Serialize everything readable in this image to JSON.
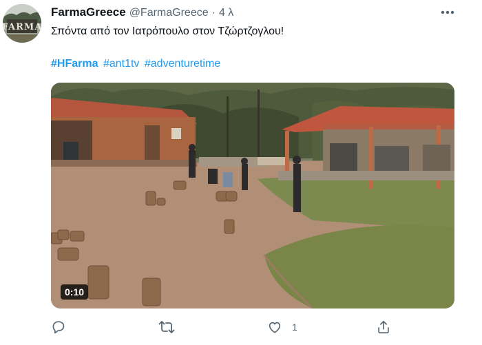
{
  "tweet": {
    "display_name": "FarmaGreece",
    "handle": "@FarmaGreece",
    "separator": "·",
    "time": "4 λ",
    "text": "Σπόντα από τον Ιατρόπουλο στον Τζώρτζογλου!",
    "hashtags": [
      "#HFarma",
      "#ant1tv",
      "#adventuretime"
    ],
    "avatar_logo_text": "FARMA",
    "media": {
      "type": "video",
      "duration": "0:10"
    },
    "actions": {
      "reply_icon": "reply-icon",
      "retweet_icon": "retweet-icon",
      "like_icon": "heart-icon",
      "like_count": "1",
      "share_icon": "share-icon"
    },
    "more_icon": "more-icon"
  },
  "colors": {
    "text": "#0f1419",
    "secondary": "#536471",
    "link": "#1d9bf0"
  }
}
